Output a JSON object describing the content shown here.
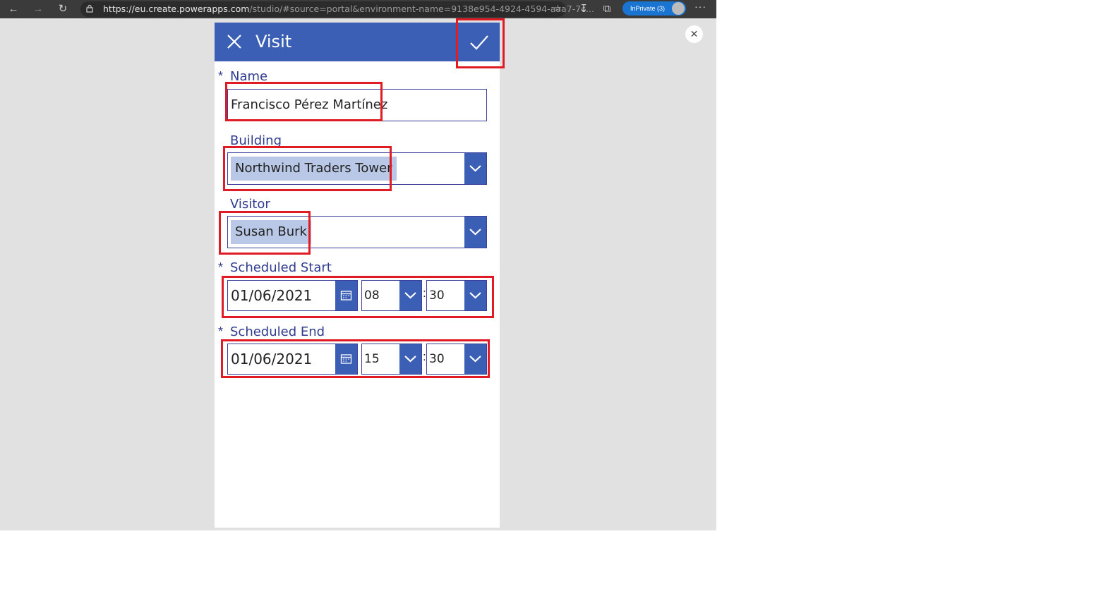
{
  "browser": {
    "url_main": "https://eu.create.powerapps.com",
    "url_rest": "/studio/#source=portal&environment-name=9138e954-4924-4594-aaa7-7c...",
    "inprivate_label": "InPrivate (3)"
  },
  "app": {
    "title": "Visit",
    "fields": {
      "name": {
        "label": "Name",
        "required": "*",
        "value": "Francisco Pérez Martínez"
      },
      "building": {
        "label": "Building",
        "value": "Northwind Traders Tower"
      },
      "visitor": {
        "label": "Visitor",
        "value": "Susan Burk"
      },
      "scheduled_start": {
        "label": "Scheduled Start",
        "required": "*",
        "date": "01/06/2021",
        "hour": "08",
        "minute": "30",
        "sep": ":"
      },
      "scheduled_end": {
        "label": "Scheduled End",
        "required": "*",
        "date": "01/06/2021",
        "hour": "15",
        "minute": "30",
        "sep": ":"
      }
    }
  },
  "colors": {
    "header": "#3a5fb4",
    "highlight": "#e01b24",
    "chip": "#b8c8e6",
    "label": "#2f3b8f"
  },
  "icons": [
    "back-icon",
    "forward-icon",
    "refresh-icon",
    "lock-icon",
    "favorites-icon",
    "downloads-icon",
    "collections-icon",
    "more-icon",
    "close-icon",
    "check-icon",
    "chevron-down-icon",
    "calendar-icon"
  ]
}
